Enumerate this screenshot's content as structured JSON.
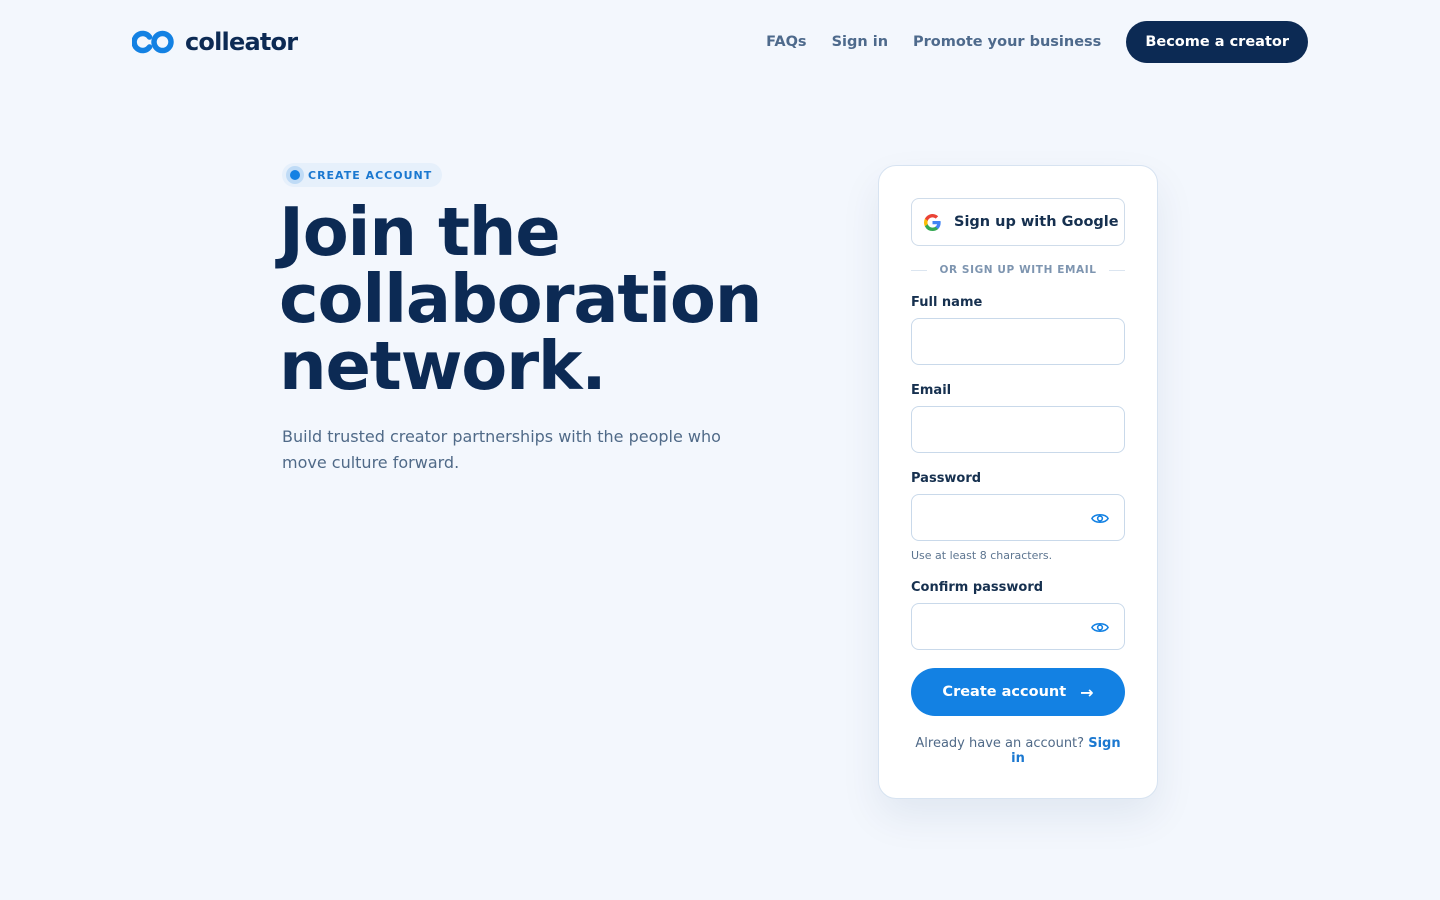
{
  "brand": {
    "name": "colleator"
  },
  "nav": {
    "links": [
      "FAQs",
      "Sign in",
      "Promote your business"
    ],
    "cta": "Become a creator"
  },
  "hero": {
    "badge": "CREATE ACCOUNT",
    "headline": [
      "Join the",
      "collaboration",
      "network."
    ],
    "subtitle": "Build trusted creator partnerships with the people who move culture forward."
  },
  "form": {
    "google_button": "Sign up with Google",
    "divider": "OR SIGN UP WITH EMAIL",
    "full_name": {
      "label": "Full name",
      "value": ""
    },
    "email": {
      "label": "Email",
      "value": ""
    },
    "password": {
      "label": "Password",
      "value": "",
      "hint": "Use at least 8 characters."
    },
    "confirm_password": {
      "label": "Confirm password",
      "value": ""
    },
    "submit": "Create account",
    "submit_icon": "arrow-right-icon",
    "footer_prefix": "Already have an account?",
    "footer_link": "Sign in"
  },
  "colors": {
    "background": "#f3f7fd",
    "navy": "#0c2a54",
    "accent": "#1381e3",
    "muted_text": "#506a88"
  }
}
